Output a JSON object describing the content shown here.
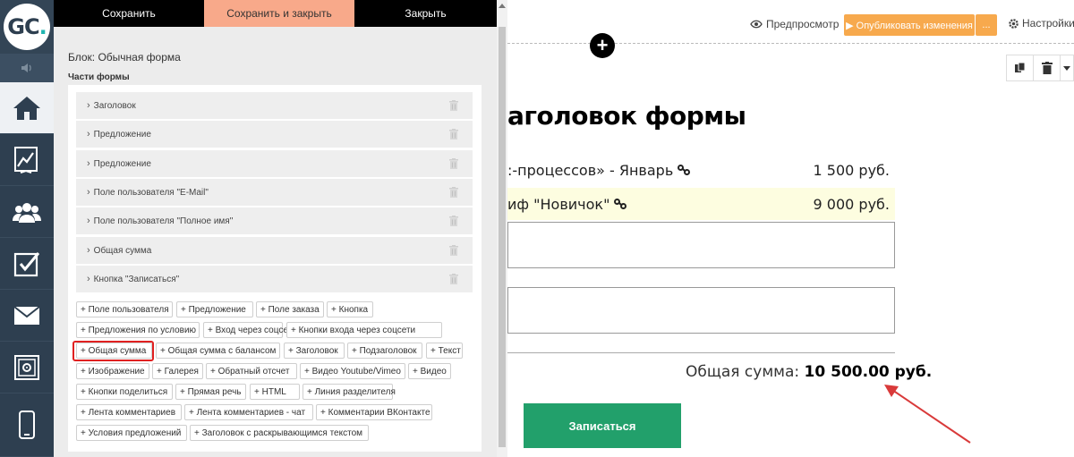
{
  "logo": {
    "text": "GC",
    "dot": "."
  },
  "topbar": {
    "save": "Сохранить",
    "save_close": "Сохранить и закрыть",
    "close": "Закрыть"
  },
  "editor": {
    "block_title": "Блок: Обычная форма",
    "parts_title": "Части формы",
    "parts": [
      "Заголовок",
      "Предложение",
      "Предложение",
      "Поле пользователя \"E-Mail\"",
      "Поле пользователя \"Полное имя\"",
      "Общая сумма",
      "Кнопка \"Записаться\""
    ],
    "add_buttons": [
      "+ Поле пользователя",
      "+ Предложение",
      "+ Поле заказа",
      "+ Кнопка",
      "+ Предложения по условию",
      "+ Вход через соцсети",
      "+ Кнопки входа через соцсети",
      "+ Общая сумма",
      "+ Общая сумма с балансом",
      "+ Заголовок",
      "+ Подзаголовок",
      "+ Текст",
      "+ Изображение",
      "+ Галерея",
      "+ Обратный отсчет",
      "+ Видео Youtube/Vimeo",
      "+ Видео",
      "+ Кнопки поделиться",
      "+ Прямая речь",
      "+ HTML",
      "+ Линия разделителя",
      "+ Лента комментариев",
      "+ Лента комментариев - чат",
      "+ Комментарии ВКонтакте",
      "+ Условия предложений",
      "+ Заголовок с раскрывающимся текстом"
    ]
  },
  "header": {
    "preview": "Предпросмотр",
    "publish": "▶ Опубликовать изменения",
    "publish_more": "...",
    "settings": "Настройки"
  },
  "form": {
    "title": "аголовок формы",
    "offers": [
      {
        "name": ":-процессов» - Январь",
        "price": "1 500 руб."
      },
      {
        "name": "иф \"Новичок\"",
        "price": "9 000 руб."
      }
    ],
    "total_label": "Общая сумма:",
    "total_value": "10 500.00 руб.",
    "submit": "Записаться"
  },
  "colors": {
    "nav_bg": "#2e3f50",
    "accent_orange": "#f7a94d",
    "submit_green": "#22a06b",
    "highlight_red": "#e02020"
  }
}
